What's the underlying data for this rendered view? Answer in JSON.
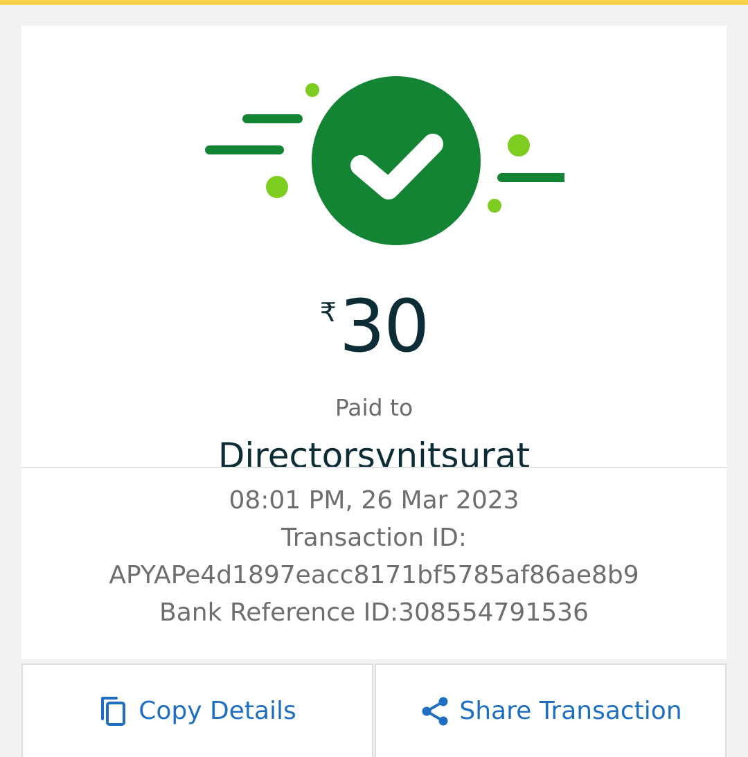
{
  "colors": {
    "accent_yellow": "#f8d34f",
    "success_green": "#138434",
    "confetti_green": "#7ccd1f",
    "text_dark": "#0c2d35",
    "text_muted": "#6e6e6e",
    "link_blue": "#1f6ec2"
  },
  "payment": {
    "currency_symbol": "₹",
    "amount": "30",
    "paid_to_label": "Paid to",
    "payee_name": "Directorsvnitsurat"
  },
  "details": {
    "datetime": "08:01 PM, 26 Mar 2023",
    "transaction_id_label": "Transaction ID:",
    "transaction_id": "APYAPe4d1897eacc8171bf5785af86ae8b9",
    "bank_reference": "Bank Reference ID:308554791536"
  },
  "actions": {
    "copy": {
      "label": "Copy Details",
      "icon": "copy-icon"
    },
    "share": {
      "label": "Share Transaction",
      "icon": "share-icon"
    }
  }
}
